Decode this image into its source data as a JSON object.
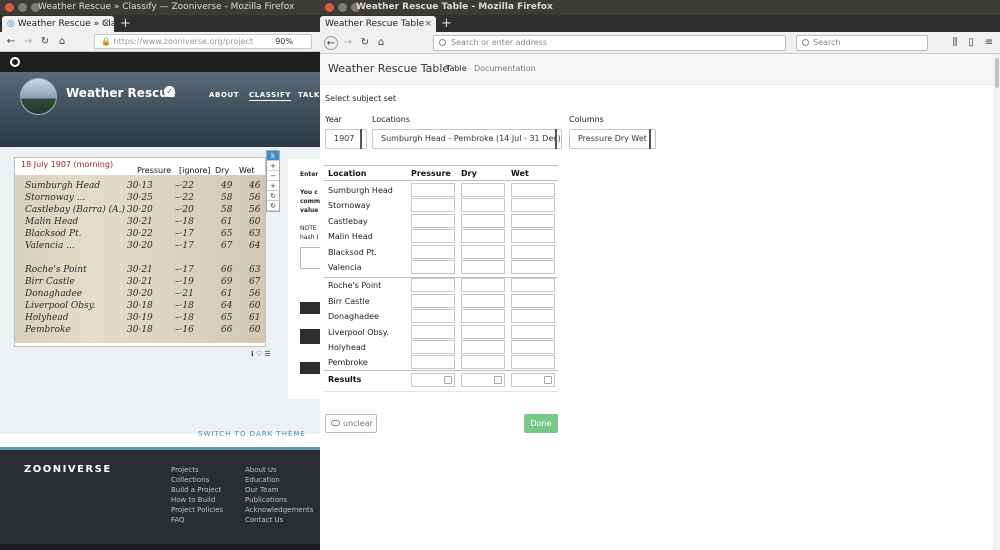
{
  "left_window": {
    "title": "Weather Rescue » Classify — Zooniverse - Mozilla Firefox",
    "tab_label": "Weather Rescue » Classi",
    "url": "https://www.zooniverse.org/project",
    "zoom": "90%",
    "project": {
      "name": "Weather Rescue",
      "nav": [
        "ABOUT",
        "CLASSIFY",
        "TALK"
      ]
    },
    "subject": {
      "date": "18 July 1907 (morning)",
      "columns": [
        "Pressure",
        "[ignore]",
        "Dry",
        "Wet"
      ],
      "rows": [
        {
          "name": "Sumburgh Head",
          "p": "30·13",
          "i": "–·22",
          "d": "49",
          "w": "46"
        },
        {
          "name": "Stornoway ...",
          "p": "30·25",
          "i": "–·22",
          "d": "58",
          "w": "56"
        },
        {
          "name": "Castlebay (Barra) (A.)",
          "p": "30·20",
          "i": "–·20",
          "d": "58",
          "w": "56"
        },
        {
          "name": "Malin Head",
          "p": "30·21",
          "i": "–·18",
          "d": "61",
          "w": "60"
        },
        {
          "name": "Blacksod Pt.",
          "p": "30·22",
          "i": "–·17",
          "d": "65",
          "w": "63"
        },
        {
          "name": "Valencia ...",
          "p": "30·20",
          "i": "–·17",
          "d": "67",
          "w": "64"
        },
        {
          "name": "Roche's Point",
          "p": "30·21",
          "i": "–·17",
          "d": "66",
          "w": "63"
        },
        {
          "name": "Birr Castle",
          "p": "30·21",
          "i": "–·19",
          "d": "69",
          "w": "67"
        },
        {
          "name": "Donaghadee",
          "p": "30·20",
          "i": "–·21",
          "d": "61",
          "w": "56"
        },
        {
          "name": "Liverpool Obsy.",
          "p": "30·18",
          "i": "–·18",
          "d": "64",
          "w": "60"
        },
        {
          "name": "Holyhead",
          "p": "30·19",
          "i": "–·18",
          "d": "65",
          "w": "61"
        },
        {
          "name": "Pembroke",
          "p": "30·18",
          "i": "–·16",
          "d": "66",
          "w": "60"
        }
      ],
      "tools": [
        "k",
        "+",
        "−",
        "+",
        "↻",
        "↻"
      ]
    },
    "task_text": {
      "enter": "Enter",
      "you": "You c",
      "comm": "comm",
      "value": "value",
      "note": "NOTE",
      "hash": "hash ("
    },
    "dark_mode": "SWITCH TO DARK THEME",
    "footer": {
      "logo": "ZOONIVERSE",
      "col1": [
        "Projects",
        "Collections",
        "Build a Project",
        "How to Build",
        "Project Policies",
        "FAQ"
      ],
      "col2": [
        "About Us",
        "Education",
        "Our Team",
        "Publications",
        "Acknowledgements",
        "Contact Us"
      ]
    }
  },
  "right_window": {
    "title": "Weather Rescue Table - Mozilla Firefox",
    "tab_label": "Weather Rescue Table",
    "url_placeholder": "Search or enter address",
    "search_placeholder": "Search",
    "app": {
      "brand": "Weather Rescue Table",
      "nav": {
        "table": "Table",
        "documentation": "Documentation"
      }
    },
    "form": {
      "heading": "Select subject set",
      "year_label": "Year",
      "year_value": "1907",
      "locations_label": "Locations",
      "locations_value": "Sumburgh Head - Pembroke (14 Jul - 31 Dec)",
      "columns_label": "Columns",
      "columns_value": "Pressure Dry Wet"
    },
    "table": {
      "headers": [
        "Location",
        "Pressure",
        "Dry",
        "Wet"
      ],
      "rows": [
        "Sumburgh Head",
        "Stornoway",
        "Castlebay",
        "Malin Head",
        "Blacksod Pt.",
        "Valencia",
        "Roche's Point",
        "Birr Castle",
        "Donaghadee",
        "Liverpool Obsy.",
        "Holyhead",
        "Pembroke"
      ],
      "results_label": "Results"
    },
    "buttons": {
      "unclear": "unclear",
      "done": "Done"
    }
  }
}
